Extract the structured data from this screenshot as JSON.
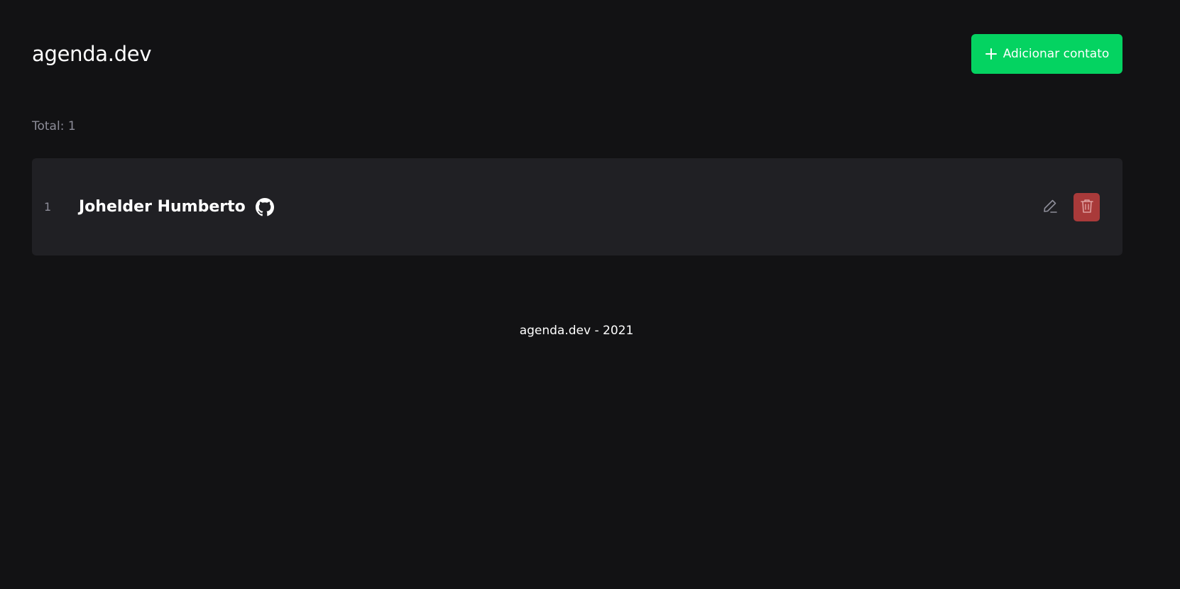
{
  "header": {
    "brand": "agenda.dev",
    "add_button_label": "Adicionar contato",
    "add_icon": "plus-icon"
  },
  "summary": {
    "total_text": "Total: 1"
  },
  "contacts": [
    {
      "index": "1",
      "name": "Johelder Humberto",
      "link_icon": "github-icon",
      "actions": [
        "edit-icon",
        "trash-icon"
      ]
    }
  ],
  "footer": {
    "text": "agenda.dev - 2021"
  },
  "colors": {
    "background": "#121214",
    "row_background": "#202024",
    "accent": "#04d361",
    "danger": "#a93a3a",
    "muted_text": "#8d8d99"
  }
}
